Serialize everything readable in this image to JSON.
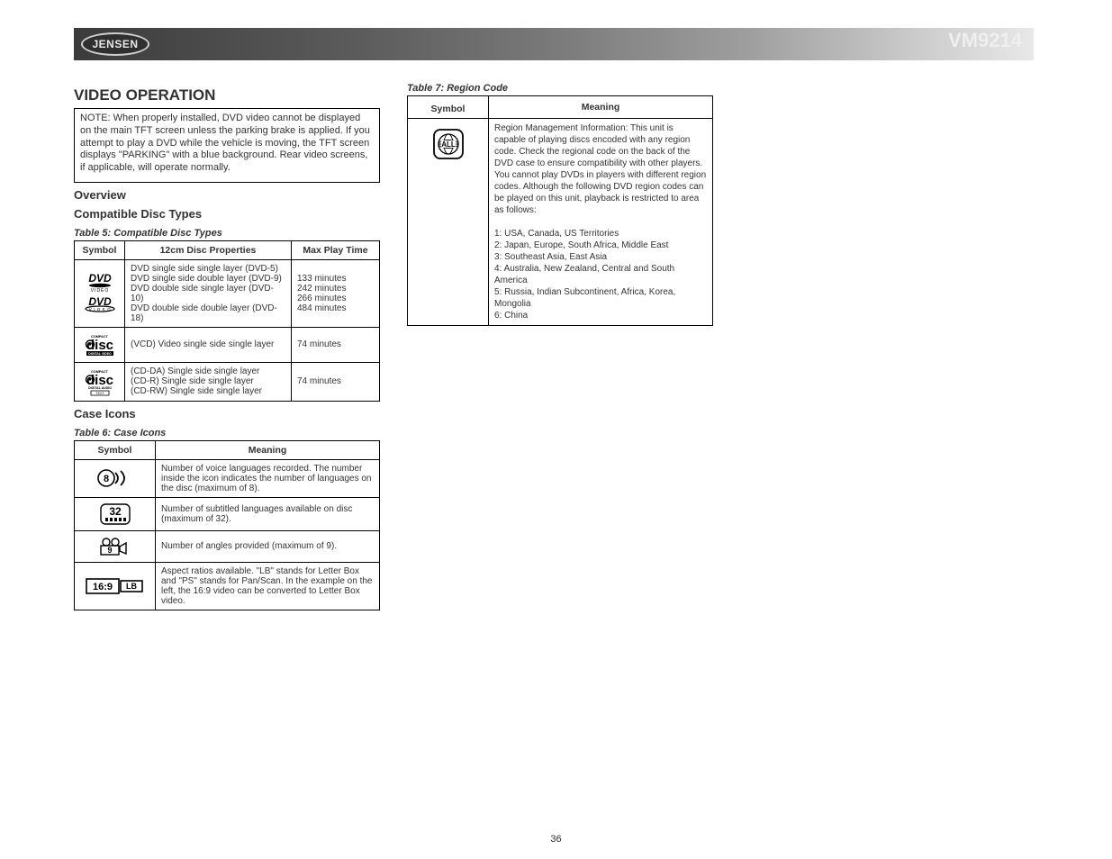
{
  "brand": "JENSEN",
  "model": "VM9214",
  "pagenum": "36",
  "section_title": "VIDEO OPERATION",
  "note_text": "NOTE: When properly installed, DVD video cannot be displayed on the main TFT screen unless the parking brake is applied. If you attempt to play a DVD while the vehicle is moving, the TFT screen displays \"PARKING\" with a blue background. Rear video screens, if applicable, will operate normally.",
  "overview_h": "Overview",
  "compat_h": "Compatible Disc Types",
  "compat_caption": "Table 5: Compatible Disc Types",
  "compat_headers": [
    "Symbol",
    "12cm Disc Properties",
    "Max Play Time"
  ],
  "compat_rows": [
    {
      "label": "DVD single side single layer (DVD-5)\nDVD single side double layer (DVD-9)\nDVD double side single layer (DVD-10)\nDVD double side double layer (DVD-18)",
      "time": "133 minutes\n242 minutes\n266 minutes\n484 minutes"
    },
    {
      "label": "(VCD) Video single side single layer",
      "time": "74 minutes"
    },
    {
      "label": "(CD-DA) Single side single layer\n(CD-R) Single side single layer\n(CD-RW) Single side single layer",
      "time": "74 minutes"
    }
  ],
  "icons_h": "Case Icons",
  "icons_caption": "Table 6: Case Icons",
  "icons_headers": [
    "Symbol",
    "Meaning"
  ],
  "icons_rows": [
    {
      "label": "Number of voice languages recorded. The number inside the icon indicates the number of languages on the disc (maximum of 8)."
    },
    {
      "label": "Number of subtitled languages available on disc (maximum of 32)."
    },
    {
      "label": "Number of angles provided (maximum of 9)."
    },
    {
      "label": "Aspect ratios available. \"LB\" stands for Letter Box and \"PS\" stands for Pan/Scan. In the example on the left, the 16:9 video can be converted to Letter Box video."
    }
  ],
  "region_caption": "Table 7: Region Code",
  "region_headers": [
    "Symbol",
    "Meaning"
  ],
  "region_row": "Region Management Information: This unit is capable of playing discs encoded with any region code. Check the regional code on the back of the DVD case to ensure compatibility with other players. You cannot play DVDs in players with different region codes. Although the following DVD region codes can be played on this unit, playback is restricted to area as follows:\n\n1: USA, Canada, US Territories\n2: Japan, Europe, South Africa, Middle East\n3: Southeast Asia, East Asia\n4: Australia, New Zealand, Central and South America\n5: Russia, Indian Subcontinent, Africa, Korea, Mongolia\n6: China"
}
